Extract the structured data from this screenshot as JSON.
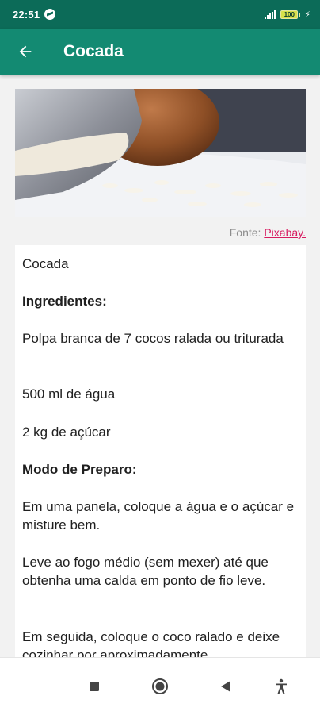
{
  "status_bar": {
    "time": "22:51",
    "battery": "100"
  },
  "app_bar": {
    "title": "Cocada"
  },
  "image_credit": {
    "prefix": "Fonte:",
    "link": "Pixabay."
  },
  "recipe": {
    "paragraphs": [
      "Cocada",
      "Ingredientes:",
      "Polpa branca de 7 cocos ralada ou triturada",
      "500 ml de água",
      "2 kg de açúcar",
      "Modo de Preparo:",
      "Em uma panela, coloque a água e o açúcar e misture bem.",
      "Leve ao fogo médio (sem mexer) até que obtenha uma calda em ponto de fio leve.",
      "Em seguida, coloque o coco ralado e deixe cozinhar por aproximadamente"
    ]
  },
  "icons": {
    "back": "arrow-left-icon",
    "messenger": "messenger-icon",
    "signal": "signal-icon",
    "battery": "battery-icon",
    "nav_recents": "square-icon",
    "nav_home": "circle-icon",
    "nav_back": "triangle-icon",
    "nav_accessibility": "accessibility-icon"
  },
  "colors": {
    "status_bar": "#0c6b58",
    "app_bar": "#138a72",
    "link": "#d81b60"
  }
}
